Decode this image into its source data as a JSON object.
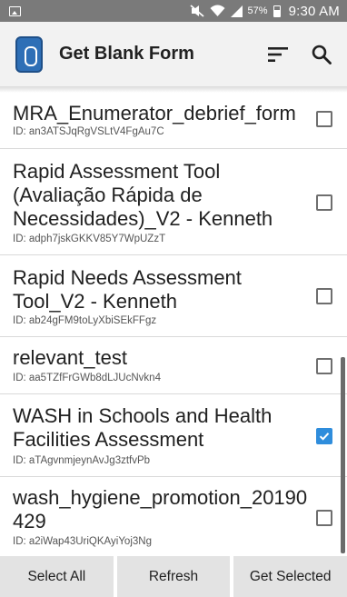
{
  "status_bar": {
    "battery_percent": "57%",
    "time": "9:30 AM"
  },
  "app_bar": {
    "title": "Get Blank Form",
    "icons": [
      "app-logo",
      "sort-icon",
      "search-icon"
    ]
  },
  "forms": [
    {
      "title": "MRA_Enumerator_debrief_form",
      "id": "ID: an3ATSJqRgVSLtV4FgAu7C",
      "checked": false
    },
    {
      "title": "Rapid Assessment Tool (Avaliação Rápida de Necessidades)_V2 - Kenneth",
      "id": "ID: adph7jskGKKV85Y7WpUZzT",
      "checked": false
    },
    {
      "title": "Rapid Needs Assessment Tool_V2 - Kenneth",
      "id": "ID: ab24gFM9toLyXbiSEkFFgz",
      "checked": false
    },
    {
      "title": "relevant_test",
      "id": "ID: aa5TZfFrGWb8dLJUcNvkn4",
      "checked": false
    },
    {
      "title": "WASH in Schools and Health Facilities Assessment",
      "id": "ID: aTAgvnmjeynAvJg3ztfvPb",
      "checked": true
    },
    {
      "title": "wash_hygiene_promotion_20190429",
      "id": "ID: a2iWap43UriQKAyiYoj3Ng",
      "checked": false
    }
  ],
  "buttons": {
    "select_all": "Select All",
    "refresh": "Refresh",
    "get_selected": "Get Selected"
  }
}
